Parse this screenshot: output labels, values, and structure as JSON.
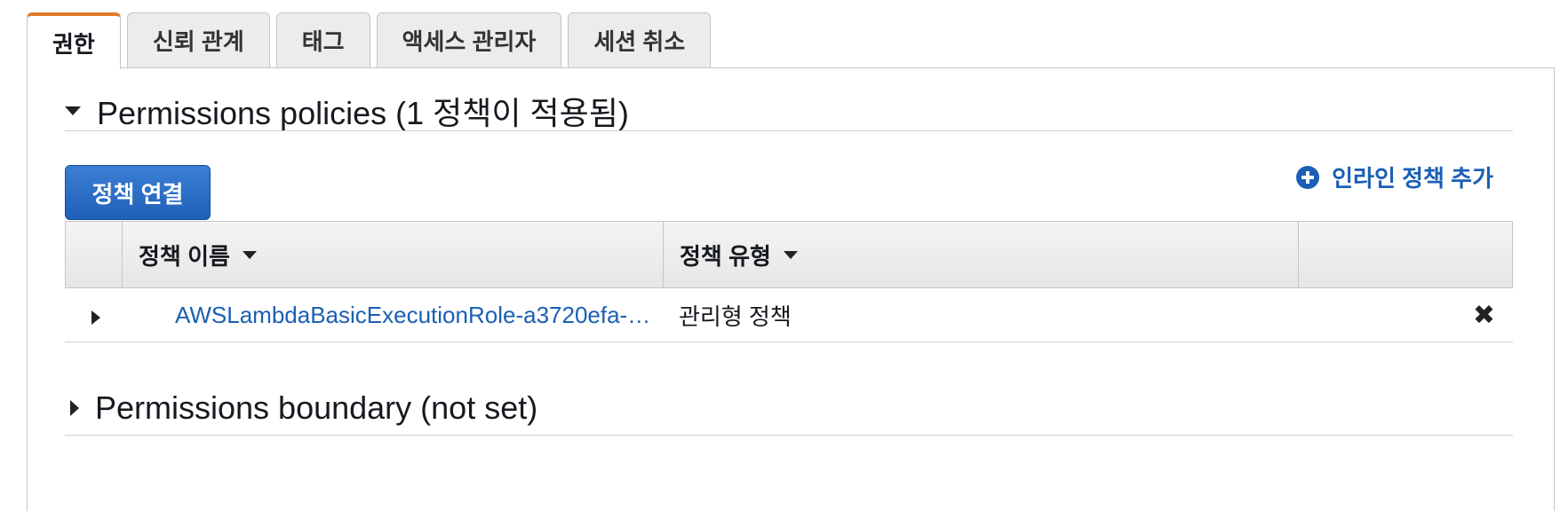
{
  "tabs": [
    "권한",
    "신뢰 관계",
    "태그",
    "액세스 관리자",
    "세션 취소"
  ],
  "active_tab": "권한",
  "permissions_policies": {
    "title": "Permissions policies (1 정책이 적용됨)",
    "attach_button": "정책 연결",
    "add_inline_link": "인라인 정책 추가",
    "columns": [
      "정책 이름",
      "정책 유형"
    ],
    "rows": [
      {
        "name": "AWSLambdaBasicExecutionRole-a3720efa-…",
        "type": "관리형 정책"
      }
    ]
  },
  "permissions_boundary": {
    "title": "Permissions boundary (not set)"
  },
  "icons": {
    "add": "plus-circle-icon",
    "remove": "close-icon",
    "expand": "caret-right-icon",
    "collapse": "caret-down-icon",
    "sort": "sort-down-icon"
  },
  "colors": {
    "accent_tab": "#e07b2b",
    "link": "#1a5fb4",
    "primary_button": "#1f5fb8"
  }
}
